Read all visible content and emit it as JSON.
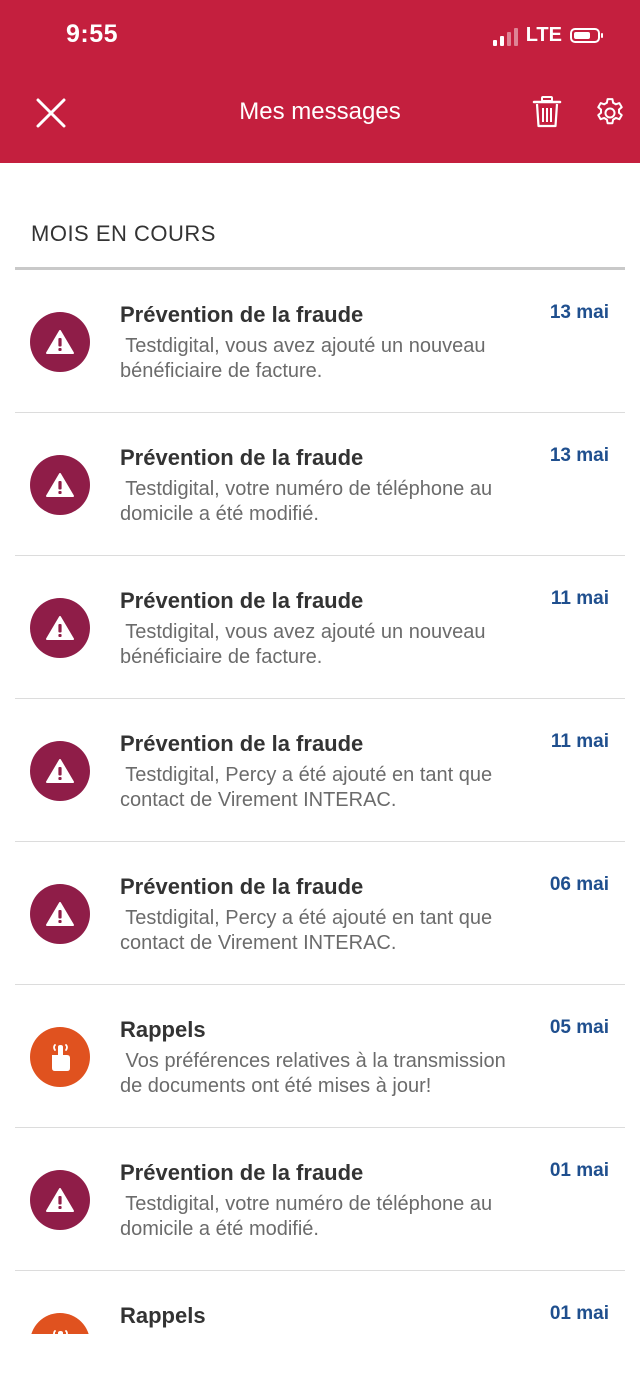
{
  "status_bar": {
    "time": "9:55",
    "network": "LTE"
  },
  "header": {
    "title": "Mes messages",
    "background": "#c41f3e"
  },
  "section": {
    "title": "MOIS EN COURS"
  },
  "colors": {
    "fraud": "#8f1d48",
    "reminder": "#e0521f",
    "date": "#1f4f8e"
  },
  "messages": [
    {
      "title": "Prévention de la fraude",
      "date": "13 mai",
      "line1": " Testdigital, vous avez ajouté un nouveau",
      "line2": "bénéficiaire de facture.",
      "icon": "warning-icon",
      "category": "fraud"
    },
    {
      "title": "Prévention de la fraude",
      "date": "13 mai",
      "line1": " Testdigital, votre numéro de téléphone au",
      "line2": "domicile a été modifié.",
      "icon": "warning-icon",
      "category": "fraud"
    },
    {
      "title": "Prévention de la fraude",
      "date": "11 mai",
      "line1": " Testdigital, vous avez ajouté un nouveau",
      "line2": "bénéficiaire de facture.",
      "icon": "warning-icon",
      "category": "fraud"
    },
    {
      "title": "Prévention de la fraude",
      "date": "11 mai",
      "line1": " Testdigital, Percy a été ajouté en tant que",
      "line2": "contact de Virement INTERAC.",
      "icon": "warning-icon",
      "category": "fraud"
    },
    {
      "title": "Prévention de la fraude",
      "date": "06 mai",
      "line1": " Testdigital, Percy a été ajouté en tant que",
      "line2": "contact de Virement INTERAC.",
      "icon": "warning-icon",
      "category": "fraud"
    },
    {
      "title": "Rappels",
      "date": "05 mai",
      "line1": " Vos préférences relatives à la transmission",
      "line2": "de documents ont été mises à jour!",
      "icon": "reminder-finger-icon",
      "category": "reminder"
    },
    {
      "title": "Prévention de la fraude",
      "date": "01 mai",
      "line1": " Testdigital, votre numéro de téléphone au",
      "line2": "domicile a été modifié.",
      "icon": "warning-icon",
      "category": "fraud"
    },
    {
      "title": "Rappels",
      "date": "01 mai",
      "line1": "",
      "line2": "",
      "icon": "reminder-finger-icon",
      "category": "reminder"
    }
  ]
}
